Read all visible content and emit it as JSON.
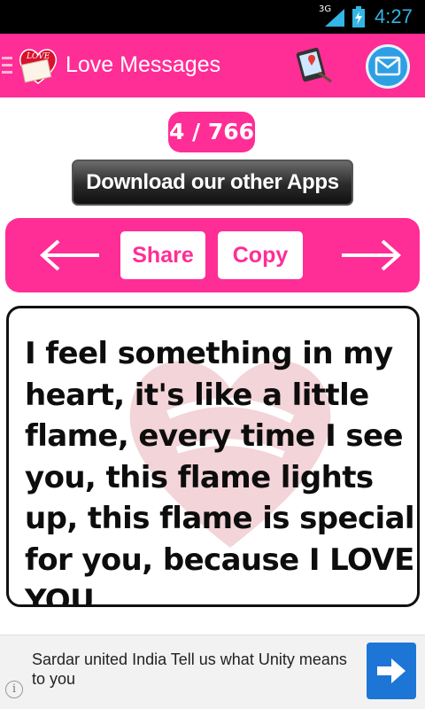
{
  "status_bar": {
    "network": "3G",
    "time": "4:27"
  },
  "action_bar": {
    "title": "Love Messages",
    "logo_text": "LOVE",
    "icons": [
      "menu-drawer-icon",
      "love-letter-logo-icon",
      "map-location-icon",
      "mail-icon"
    ]
  },
  "counter": {
    "text": "4 / 766"
  },
  "download_button": {
    "label": "Download our other Apps"
  },
  "nav": {
    "share_label": "Share",
    "copy_label": "Copy",
    "prev_icon": "arrow-left-icon",
    "next_icon": "arrow-right-icon"
  },
  "message": {
    "text": "I feel something in my heart, it's like a little flame, every time I see you, this flame lights up, this flame is special for you, because I LOVE YOU"
  },
  "ad": {
    "text": "Sardar united India Tell us what Unity means to you",
    "info_glyph": "i",
    "go_icon": "arrow-right-icon"
  },
  "colors": {
    "brand_pink": "#ff2d96",
    "status_blue": "#33b5e5",
    "mail_blue": "#2f9fe3",
    "ad_button_blue": "#1d76d6"
  }
}
